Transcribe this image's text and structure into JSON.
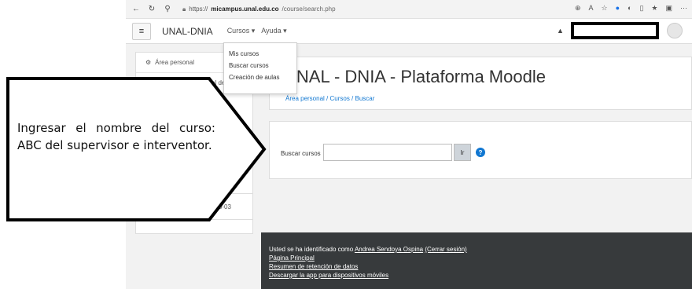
{
  "browser": {
    "url_domain": "micampus.unal.edu.co",
    "url_prefix": "https://",
    "url_path": "/course/search.php"
  },
  "navbar": {
    "brand": "UNAL-DNIA",
    "menu_courses": "Cursos ▾",
    "menu_help": "Ayuda ▾"
  },
  "dropdown": {
    "items": [
      "Mis cursos",
      "Buscar cursos",
      "Creación de aulas"
    ]
  },
  "drawer": {
    "item_personal": "Área personal",
    "item_partial": "al del s",
    "item_date": "023-03"
  },
  "main": {
    "title": "UNAL - DNIA - Plataforma Moodle",
    "breadcrumb": "Área personal / Cursos / Buscar",
    "search_label": "Buscar cursos",
    "search_value": "",
    "go_label": "Ir"
  },
  "footer": {
    "logged_prefix": "Usted se ha identificado como ",
    "user_name": "Andrea Sendoya Ospina",
    "logout": "(Cerrar sesión)",
    "link_home": "Página Principal",
    "link_retention": "Resumen de retención de datos",
    "link_app": "Descargar la app para dispositivos móviles"
  },
  "callout": {
    "text": "Ingresar el nombre del curso: ABC del supervisor e interventor."
  },
  "colors": {
    "link": "#1177d1",
    "footer_bg": "#373a3c",
    "drawer_bg": "#f2f2f2"
  }
}
